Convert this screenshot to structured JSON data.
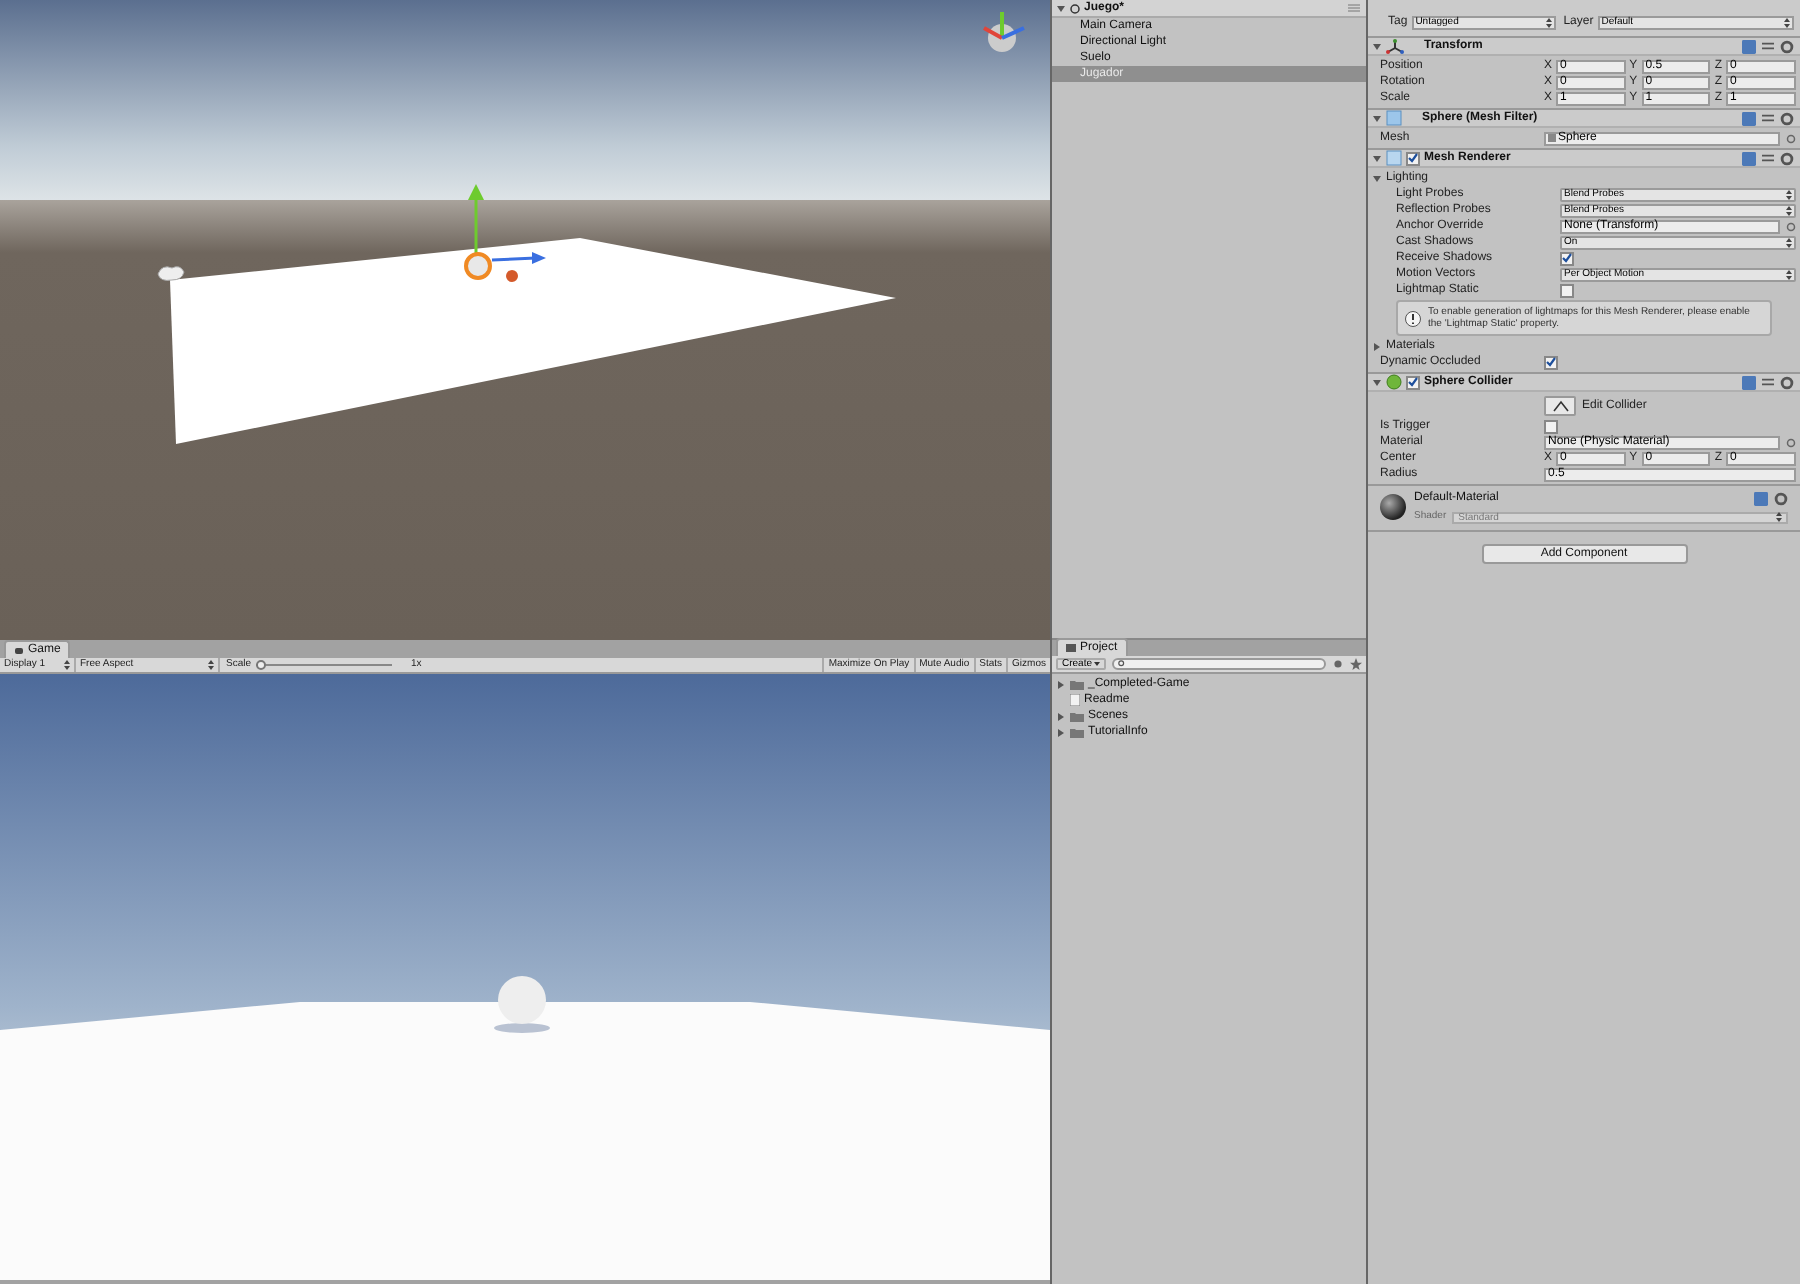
{
  "game_view": {
    "tab": "Game",
    "display": "Display 1",
    "aspect": "Free Aspect",
    "scale_label": "Scale",
    "scale": {
      "level": 0.03
    },
    "scale_value": "1x",
    "buttons": [
      "Maximize On Play",
      "Mute Audio",
      "Stats",
      "Gizmos"
    ]
  },
  "hierarchy": {
    "scene": "Juego*",
    "expanded": true,
    "items": [
      {
        "label": "Main Camera",
        "selected": false
      },
      {
        "label": "Directional Light",
        "selected": false
      },
      {
        "label": "Suelo",
        "selected": false
      },
      {
        "label": "Jugador",
        "selected": true
      }
    ]
  },
  "project": {
    "tab": "Project",
    "create": "Create",
    "items": [
      {
        "kind": "folder",
        "label": "_Completed-Game",
        "expanded": false
      },
      {
        "kind": "file",
        "label": "Readme"
      },
      {
        "kind": "folder",
        "label": "Scenes",
        "expanded": false
      },
      {
        "kind": "folder",
        "label": "TutorialInfo",
        "expanded": false
      }
    ]
  },
  "inspector": {
    "tag_label": "Tag",
    "tag": "Untagged",
    "layer_label": "Layer",
    "layer": "Default",
    "components": [
      {
        "kind": "transform",
        "title": "Transform",
        "expanded": true,
        "rows": [
          {
            "kind": "vector",
            "label": "Position",
            "values": [
              {
                "axis": "X",
                "value": "0"
              },
              {
                "axis": "Y",
                "value": "0.5"
              },
              {
                "axis": "Z",
                "value": "0"
              }
            ]
          },
          {
            "kind": "vector",
            "label": "Rotation",
            "values": [
              {
                "axis": "X",
                "value": "0"
              },
              {
                "axis": "Y",
                "value": "0"
              },
              {
                "axis": "Z",
                "value": "0"
              }
            ]
          },
          {
            "kind": "vector",
            "label": "Scale",
            "values": [
              {
                "axis": "X",
                "value": "1"
              },
              {
                "axis": "Y",
                "value": "1"
              },
              {
                "axis": "Z",
                "value": "1"
              }
            ]
          }
        ]
      },
      {
        "kind": "mesh_filter",
        "title": "Sphere (Mesh Filter)",
        "expanded": true,
        "rows": [
          {
            "kind": "object",
            "label": "Mesh",
            "value": "Sphere",
            "asset": true
          }
        ]
      },
      {
        "kind": "mesh_renderer",
        "title": "Mesh Renderer",
        "enabled": true,
        "expanded": true,
        "rows": [
          {
            "kind": "foldout",
            "label": "Lighting",
            "expanded": true,
            "children": [
              {
                "kind": "dropdown",
                "label": "Light Probes",
                "value": "Blend Probes"
              },
              {
                "kind": "dropdown",
                "label": "Reflection Probes",
                "value": "Blend Probes"
              },
              {
                "kind": "object",
                "label": "Anchor Override",
                "value": "None (Transform)",
                "asset": false
              },
              {
                "kind": "dropdown",
                "label": "Cast Shadows",
                "value": "On"
              },
              {
                "kind": "checkbox",
                "label": "Receive Shadows",
                "checked": true
              },
              {
                "kind": "dropdown",
                "label": "Motion Vectors",
                "value": "Per Object Motion"
              },
              {
                "kind": "checkbox",
                "label": "Lightmap Static",
                "checked": false
              },
              {
                "kind": "note",
                "text": "To enable generation of lightmaps for this Mesh Renderer, please enable the 'Lightmap Static' property."
              }
            ]
          },
          {
            "kind": "foldout",
            "label": "Materials",
            "expanded": false,
            "children": []
          },
          {
            "kind": "checkbox",
            "label": "Dynamic Occluded",
            "checked": true
          }
        ]
      },
      {
        "kind": "collider",
        "title": "Sphere Collider",
        "enabled": true,
        "expanded": true,
        "rows": [
          {
            "kind": "edit",
            "label": "Edit Collider"
          },
          {
            "kind": "checkbox",
            "label": "Is Trigger",
            "checked": false
          },
          {
            "kind": "object",
            "label": "Material",
            "value": "None (Physic Material)",
            "asset": false
          },
          {
            "kind": "vector",
            "label": "Center",
            "values": [
              {
                "axis": "X",
                "value": "0"
              },
              {
                "axis": "Y",
                "value": "0"
              },
              {
                "axis": "Z",
                "value": "0"
              }
            ]
          },
          {
            "kind": "text",
            "label": "Radius",
            "value": "0.5"
          }
        ]
      }
    ],
    "material": {
      "name": "Default-Material",
      "shader_label": "Shader",
      "shader": "Standard"
    },
    "add_component": "Add Component"
  }
}
